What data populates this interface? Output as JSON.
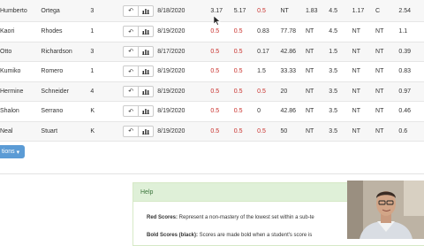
{
  "students": [
    {
      "first": "Humberto",
      "last": "Ortega",
      "grade": "3",
      "date": "8/18/2020",
      "s1": "3.17",
      "s2": "5.17",
      "s3": "0.5",
      "s4": "NT",
      "s5": "1.83",
      "s6": "4.5",
      "s7": "1.17",
      "s8": "C",
      "s9": "2.54",
      "s1_red": false,
      "s2_red": false,
      "s3_red": true
    },
    {
      "first": "Kaori",
      "last": "Rhodes",
      "grade": "1",
      "date": "8/19/2020",
      "s1": "0.5",
      "s2": "0.5",
      "s3": "0.83",
      "s4": "77.78",
      "s5": "NT",
      "s6": "4.5",
      "s7": "NT",
      "s8": "NT",
      "s9": "1.1",
      "s1_red": true,
      "s2_red": true,
      "s3_red": false
    },
    {
      "first": "Otto",
      "last": "Richardson",
      "grade": "3",
      "date": "8/17/2020",
      "s1": "0.5",
      "s2": "0.5",
      "s3": "0.17",
      "s4": "42.86",
      "s5": "NT",
      "s6": "1.5",
      "s7": "NT",
      "s8": "NT",
      "s9": "0.39",
      "s1_red": true,
      "s2_red": true,
      "s3_red": false
    },
    {
      "first": "Kumiko",
      "last": "Romero",
      "grade": "1",
      "date": "8/19/2020",
      "s1": "0.5",
      "s2": "0.5",
      "s3": "1.5",
      "s4": "33.33",
      "s5": "NT",
      "s6": "3.5",
      "s7": "NT",
      "s8": "NT",
      "s9": "0.83",
      "s1_red": true,
      "s2_red": true,
      "s3_red": false
    },
    {
      "first": "Hermine",
      "last": "Schneider",
      "grade": "4",
      "date": "8/19/2020",
      "s1": "0.5",
      "s2": "0.5",
      "s3": "0.5",
      "s4": "20",
      "s5": "NT",
      "s6": "3.5",
      "s7": "NT",
      "s8": "NT",
      "s9": "0.97",
      "s1_red": true,
      "s2_red": true,
      "s3_red": true
    },
    {
      "first": "Shalon",
      "last": "Serrano",
      "grade": "K",
      "date": "8/19/2020",
      "s1": "0.5",
      "s2": "0.5",
      "s3": "0",
      "s4": "42.86",
      "s5": "NT",
      "s6": "3.5",
      "s7": "NT",
      "s8": "NT",
      "s9": "0.46",
      "s1_red": true,
      "s2_red": true,
      "s3_red": false
    },
    {
      "first": "Neal",
      "last": "Stuart",
      "grade": "K",
      "date": "8/19/2020",
      "s1": "0.5",
      "s2": "0.5",
      "s3": "0.5",
      "s4": "50",
      "s5": "NT",
      "s6": "3.5",
      "s7": "NT",
      "s8": "NT",
      "s9": "0.6",
      "s1_red": true,
      "s2_red": true,
      "s3_red": true
    }
  ],
  "icons": {
    "undo": "undo-arrow-icon",
    "chart": "bar-chart-icon",
    "caret": "caret-down-icon"
  },
  "actions_button": {
    "label": "tions"
  },
  "help": {
    "heading": "Help",
    "red_title": "Red Scores:",
    "red_text": " Represent a non-mastery of the lowest set within a sub-te",
    "bold_title": "Bold Scores (black):",
    "bold_text": " Scores are made bold when a student's score is"
  },
  "colors": {
    "red_score": "#c9302c",
    "help_heading_bg": "#dff0d8",
    "help_heading_text": "#3c763d",
    "button_blue": "#5b9bd5"
  }
}
